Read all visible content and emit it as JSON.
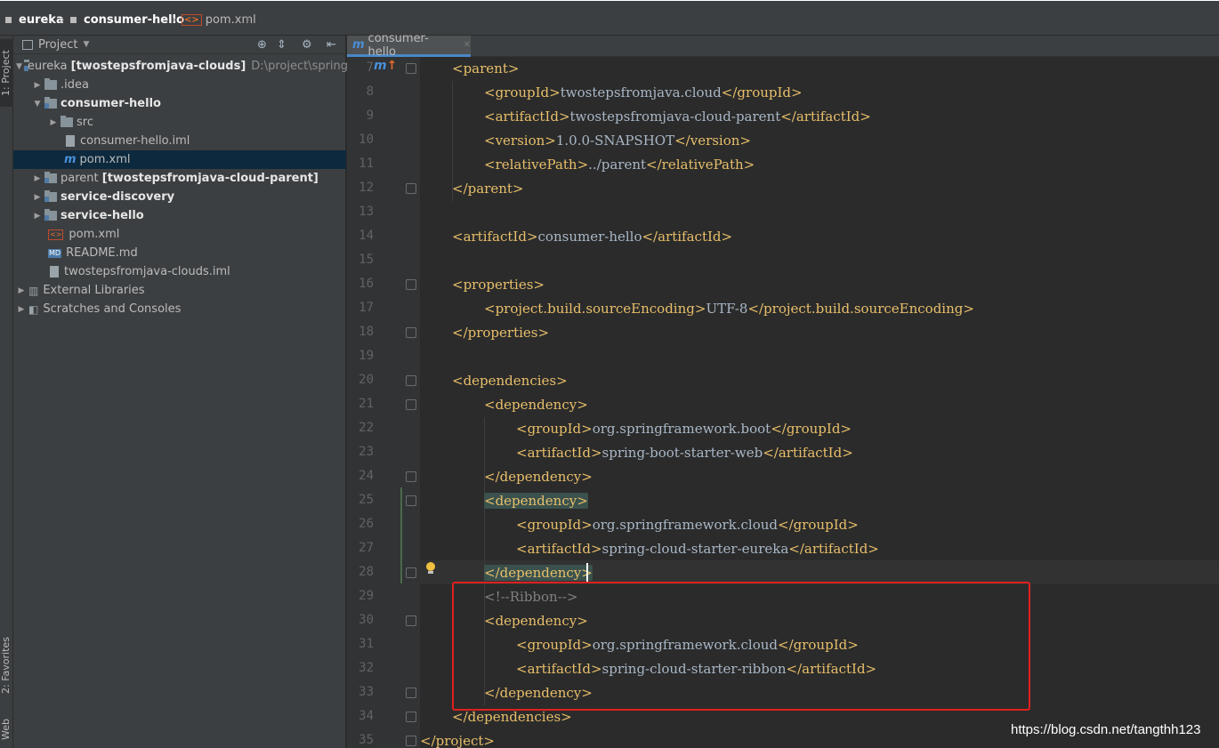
{
  "breadcrumbs": [
    "eureka",
    "consumer-hello",
    "pom.xml"
  ],
  "left_strip": {
    "project_tab": "1: Project",
    "favorites_tab": "2: Favorites",
    "web_tab": "Web"
  },
  "project_panel": {
    "title": "Project",
    "tree": [
      {
        "label": "eureka",
        "suffix": "[twostepsfromjava-clouds]",
        "path": "D:\\project\\springClo"
      },
      {
        "label": ".idea"
      },
      {
        "label": "consumer-hello"
      },
      {
        "label": "src"
      },
      {
        "label": "consumer-hello.iml"
      },
      {
        "label": "pom.xml"
      },
      {
        "label": "parent",
        "suffix": "[twostepsfromjava-cloud-parent]"
      },
      {
        "label": "service-discovery"
      },
      {
        "label": "service-hello"
      },
      {
        "label": "pom.xml"
      },
      {
        "label": "README.md"
      },
      {
        "label": "twostepsfromjava-clouds.iml"
      },
      {
        "label": "External Libraries"
      },
      {
        "label": "Scratches and Consoles"
      }
    ]
  },
  "editor": {
    "tab_label": "consumer-hello",
    "lines": [
      {
        "n": "7"
      },
      {
        "n": "8"
      },
      {
        "n": "9"
      },
      {
        "n": "10"
      },
      {
        "n": "11"
      },
      {
        "n": "12"
      },
      {
        "n": "13"
      },
      {
        "n": "14"
      },
      {
        "n": "15"
      },
      {
        "n": "16"
      },
      {
        "n": "17"
      },
      {
        "n": "18"
      },
      {
        "n": "19"
      },
      {
        "n": "20"
      },
      {
        "n": "21"
      },
      {
        "n": "22"
      },
      {
        "n": "23"
      },
      {
        "n": "24"
      },
      {
        "n": "25"
      },
      {
        "n": "26"
      },
      {
        "n": "27"
      },
      {
        "n": "28"
      },
      {
        "n": "29"
      },
      {
        "n": "30"
      },
      {
        "n": "31"
      },
      {
        "n": "32"
      },
      {
        "n": "33"
      },
      {
        "n": "34"
      },
      {
        "n": "35"
      }
    ],
    "code": {
      "l7": {
        "o": "<parent>"
      },
      "l8": {
        "o": "<groupId>",
        "t": "twostepsfromjava.cloud",
        "c": "</groupId>"
      },
      "l9": {
        "o": "<artifactId>",
        "t": "twostepsfromjava-cloud-parent",
        "c": "</artifactId>"
      },
      "l10": {
        "o": "<version>",
        "t": "1.0.0-SNAPSHOT",
        "c": "</version>"
      },
      "l11": {
        "o": "<relativePath>",
        "t": "../parent",
        "c": "</relativePath>"
      },
      "l12": {
        "o": "</parent>"
      },
      "l14": {
        "o": "<artifactId>",
        "t": "consumer-hello",
        "c": "</artifactId>"
      },
      "l16": {
        "o": "<properties>"
      },
      "l17": {
        "o": "<project.build.sourceEncoding>",
        "t": "UTF-8",
        "c": "</project.build.sourceEncoding>"
      },
      "l18": {
        "o": "</properties>"
      },
      "l20": {
        "o": "<dependencies>"
      },
      "l21": {
        "o": "<dependency>"
      },
      "l22": {
        "o": "<groupId>",
        "t": "org.springframework.boot",
        "c": "</groupId>"
      },
      "l23": {
        "o": "<artifactId>",
        "t": "spring-boot-starter-web",
        "c": "</artifactId>"
      },
      "l24": {
        "o": "</dependency>"
      },
      "l25": {
        "o": "<dependency>"
      },
      "l26": {
        "o": "<groupId>",
        "t": "org.springframework.cloud",
        "c": "</groupId>"
      },
      "l27": {
        "o": "<artifactId>",
        "t": "spring-cloud-starter-eureka",
        "c": "</artifactId>"
      },
      "l28": {
        "o": "</dependency>"
      },
      "l29": {
        "cm": "<!--Ribbon-->"
      },
      "l30": {
        "o": "<dependency>"
      },
      "l31": {
        "o": "<groupId>",
        "t": "org.springframework.cloud",
        "c": "</groupId>"
      },
      "l32": {
        "o": "<artifactId>",
        "t": "spring-cloud-starter-ribbon",
        "c": "</artifactId>"
      },
      "l33": {
        "o": "</dependency>"
      },
      "l34": {
        "o": "</dependencies>"
      },
      "l35": {
        "o": "</project>"
      }
    }
  },
  "watermark": "https://blog.csdn.net/tangthh123",
  "colors": {
    "tag": "#e8bf6a",
    "text": "#a9b7c6",
    "comment": "#808080",
    "highlight_box": "#e02020",
    "selection": "#0d293e"
  }
}
